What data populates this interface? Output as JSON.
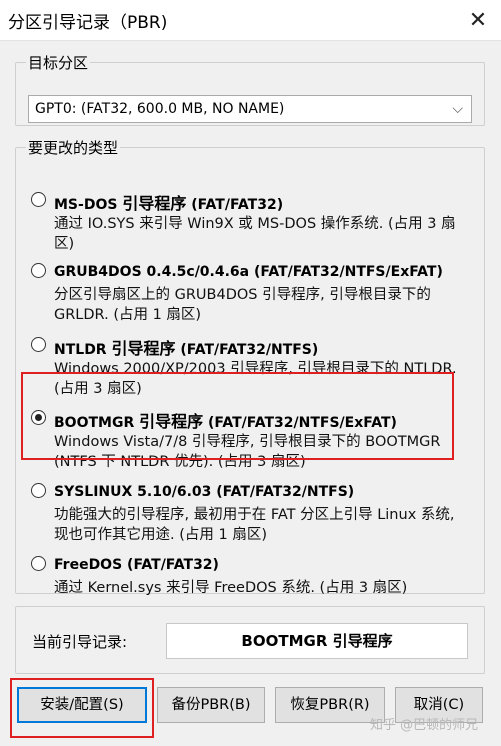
{
  "window": {
    "title": "分区引导记录（PBR)",
    "close_label": "✕"
  },
  "target": {
    "legend": "目标分区",
    "selected": "GPT0: (FAT32, 600.0 MB, NO NAME)",
    "chevron": "⌵"
  },
  "types": {
    "legend": "要更改的类型",
    "options": [
      {
        "name_pre": "MS-DOS ",
        "name_big": "引导程序",
        "name_post": " (FAT/FAT32)",
        "desc": "通过 IO.SYS 来引导 Win9X 或 MS-DOS 操作系统. (占用 3 扇区)",
        "checked": false
      },
      {
        "name_pre": "GRUB4DOS 0.4.5c/0.4.6a (FAT/FAT32/NTFS/ExFAT)",
        "name_big": "",
        "name_post": "",
        "desc": "分区引导扇区上的 GRUB4DOS 引导程序, 引导根目录下的 GRLDR. (占用 1 扇区)",
        "checked": false
      },
      {
        "name_pre": "NTLDR ",
        "name_big": "引导程序",
        "name_post": " (FAT/FAT32/NTFS)",
        "desc": "Windows 2000/XP/2003 引导程序, 引导根目录下的 NTLDR. (占用 3 扇区)",
        "checked": false
      },
      {
        "name_pre": "BOOTMGR ",
        "name_big": "引导程序",
        "name_post": " (FAT/FAT32/NTFS/ExFAT)",
        "desc": "Windows Vista/7/8 引导程序, 引导根目录下的 BOOTMGR (NTFS 下 NTLDR 优先). (占用 3 扇区)",
        "checked": true
      },
      {
        "name_pre": "SYSLINUX 5.10/6.03 (FAT/FAT32/NTFS)",
        "name_big": "",
        "name_post": "",
        "desc": "功能强大的引导程序, 最初用于在 FAT 分区上引导 Linux 系统, 现也可作其它用途. (占用 1 扇区)",
        "checked": false
      },
      {
        "name_pre": "FreeDOS (FAT/FAT32)",
        "name_big": "",
        "name_post": "",
        "desc": "通过 Kernel.sys 来引导 FreeDOS 系统. (占用 3 扇区)",
        "checked": false
      }
    ]
  },
  "current": {
    "label": "当前引导记录:",
    "value": "BOOTMGR 引导程序"
  },
  "buttons": {
    "install": "安装/配置(S)",
    "backup": "备份PBR(B)",
    "restore": "恢复PBR(R)",
    "cancel": "取消(C)"
  },
  "watermark": "知乎 @巴顿的师兄",
  "colors": {
    "highlight": "#e02020",
    "focus": "#0078d7"
  }
}
